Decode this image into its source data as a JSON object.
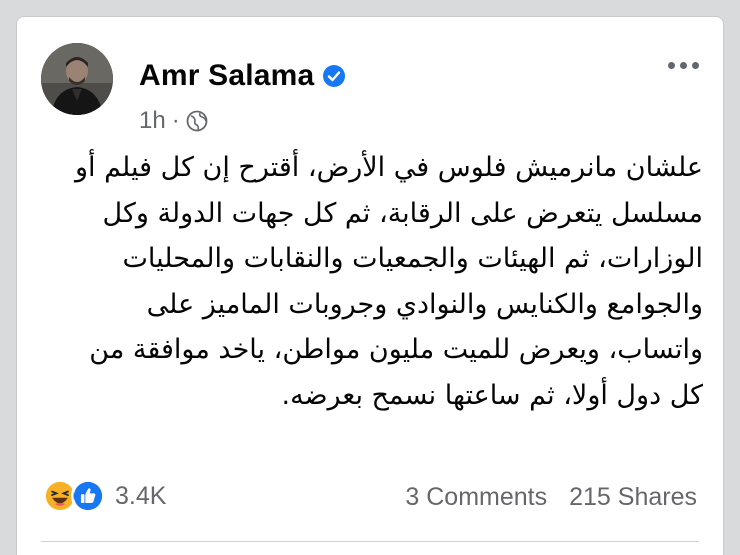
{
  "post": {
    "author": "Amr Salama",
    "time": "1h",
    "separator": "·",
    "text": "علشان مانرميش فلوس في الأرض، أقترح إن كل فيلم أو\nمسلسل يتعرض على الرقابة، ثم كل جهات الدولة وكل\nالوزارات، ثم الهيئات والجمعيات والنقابات والمحليات\nوالجوامع والكنايس والنوادي وجروبات الماميز على\nواتساب، ويعرض للميت مليون مواطن، ياخد موافقة من\nكل دول أولا، ثم ساعتها نسمح بعرضه."
  },
  "engagement": {
    "reaction_count": "3.4K",
    "comments": "3 Comments",
    "shares": "215 Shares"
  },
  "icons": {
    "verified": "verified-badge-icon",
    "audience": "globe-icon",
    "more": "more-options-icon",
    "reaction_1": "haha-reaction-icon",
    "reaction_2": "like-reaction-icon"
  },
  "colors": {
    "verified_blue": "#1877f2",
    "secondary_text": "#65676b",
    "haha_yellow": "#f7b125"
  }
}
